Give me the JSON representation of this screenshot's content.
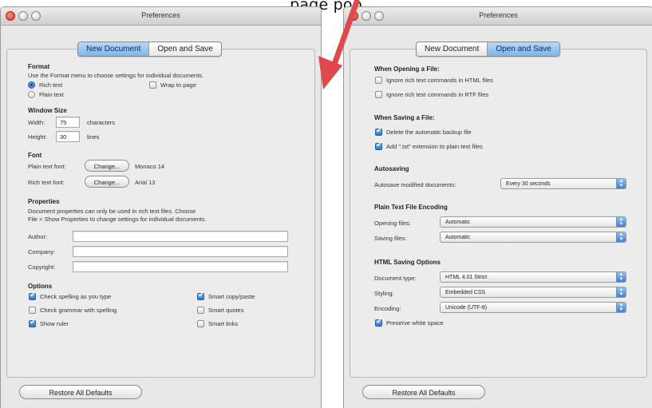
{
  "caption": "page pop",
  "left_window": {
    "title": "Preferences",
    "tabs": [
      "New Document",
      "Open and Save"
    ],
    "format": {
      "heading": "Format",
      "desc": "Use the Format menu to choose settings for individual documents.",
      "rich": "Rich text",
      "plain": "Plain text",
      "wrap": "Wrap to page"
    },
    "window_size": {
      "heading": "Window Size",
      "width_label": "Width:",
      "width_value": "75",
      "width_unit": "characters",
      "height_label": "Height:",
      "height_value": "30",
      "height_unit": "lines"
    },
    "font": {
      "heading": "Font",
      "plain_label": "Plain text font:",
      "rich_label": "Rich text font:",
      "change": "Change...",
      "plain_font": "Monaco 14",
      "rich_font": "Arial 13"
    },
    "properties": {
      "heading": "Properties",
      "desc1": "Document properties can only be used in rich text files. Choose",
      "desc2": "File > Show Properties to change settings for individual documents.",
      "author": "Author:",
      "company": "Company:",
      "copyright": "Copyright:"
    },
    "options": {
      "heading": "Options",
      "check_spelling": "Check spelling as you type",
      "check_grammar": "Check grammar with spelling",
      "show_ruler": "Show ruler",
      "smart_copy": "Smart copy/paste",
      "smart_quotes": "Smart quotes",
      "smart_links": "Smart links"
    },
    "restore": "Restore All Defaults"
  },
  "right_window": {
    "title": "Preferences",
    "tabs": [
      "New Document",
      "Open and Save"
    ],
    "opening": {
      "heading": "When Opening a File:",
      "ignore_html": "Ignore rich text commands in HTML files",
      "ignore_rtf": "Ignore rich text commands in RTF files"
    },
    "saving": {
      "heading": "When Saving a File:",
      "delete_backup": "Delete the automatic backup file",
      "add_txt": "Add \".txt\" extension to plain text files"
    },
    "autosaving": {
      "heading": "Autosaving",
      "label": "Autosave modified documents:",
      "value": "Every 30 seconds"
    },
    "encoding": {
      "heading": "Plain Text File Encoding",
      "opening_label": "Opening files:",
      "opening_value": "Automatic",
      "saving_label": "Saving files:",
      "saving_value": "Automatic"
    },
    "html": {
      "heading": "HTML Saving Options",
      "doctype_label": "Document type:",
      "doctype_value": "HTML 4.01 Strict",
      "styling_label": "Styling:",
      "styling_value": "Embedded CSS",
      "encoding_label": "Encoding:",
      "encoding_value": "Unicode (UTF-8)",
      "preserve": "Preserve white space"
    },
    "restore": "Restore All Defaults"
  },
  "colors": {
    "accent": "#3b81d6",
    "arrow": "#e0484a"
  }
}
